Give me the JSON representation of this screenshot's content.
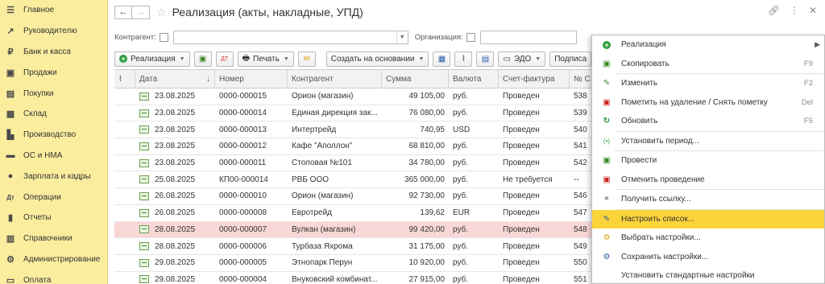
{
  "sidebar": {
    "items": [
      {
        "label": "Главное",
        "icon": "menu-icon"
      },
      {
        "label": "Руководителю",
        "icon": "chart-icon"
      },
      {
        "label": "Банк и касса",
        "icon": "bank-icon"
      },
      {
        "label": "Продажи",
        "icon": "sales-icon"
      },
      {
        "label": "Покупки",
        "icon": "cart-icon"
      },
      {
        "label": "Склад",
        "icon": "warehouse-icon"
      },
      {
        "label": "Производство",
        "icon": "factory-icon"
      },
      {
        "label": "ОС и НМА",
        "icon": "truck-icon"
      },
      {
        "label": "Зарплата и кадры",
        "icon": "people-icon"
      },
      {
        "label": "Операции",
        "icon": "operations-icon"
      },
      {
        "label": "Отчеты",
        "icon": "reports-icon"
      },
      {
        "label": "Справочники",
        "icon": "book-icon"
      },
      {
        "label": "Администрирование",
        "icon": "gear-icon"
      },
      {
        "label": "Оплата",
        "icon": "payment-icon"
      }
    ]
  },
  "header": {
    "title": "Реализация (акты, накладные, УПД)"
  },
  "filters": {
    "counterparty_label": "Контрагент:",
    "organization_label": "Организация:"
  },
  "toolbar": {
    "create_label": "Реализация",
    "print_label": "Печать",
    "create_based_label": "Создать на основании",
    "edo_label": "ЭДО",
    "sign_label": "Подписа"
  },
  "table": {
    "columns": [
      "Дата",
      "Номер",
      "Контрагент",
      "Сумма",
      "Валюта",
      "Счет-фактура",
      "№ С"
    ],
    "rows": [
      {
        "date": "23.08.2025",
        "number": "0000-000015",
        "counterparty": "Орион (магазин)",
        "sum": "49 105,00",
        "currency": "руб.",
        "invoice": "Проведен",
        "num": "538"
      },
      {
        "date": "23.08.2025",
        "number": "0000-000014",
        "counterparty": "Единая дирекция зак...",
        "sum": "76 080,00",
        "currency": "руб.",
        "invoice": "Проведен",
        "num": "539"
      },
      {
        "date": "23.08.2025",
        "number": "0000-000013",
        "counterparty": "Интертрейд",
        "sum": "740,95",
        "currency": "USD",
        "invoice": "Проведен",
        "num": "540"
      },
      {
        "date": "23.08.2025",
        "number": "0000-000012",
        "counterparty": "Кафе \"Аполлон\"",
        "sum": "68 810,00",
        "currency": "руб.",
        "invoice": "Проведен",
        "num": "541"
      },
      {
        "date": "23.08.2025",
        "number": "0000-000011",
        "counterparty": "Столовая №101",
        "sum": "34 780,00",
        "currency": "руб.",
        "invoice": "Проведен",
        "num": "542"
      },
      {
        "date": "25.08.2025",
        "number": "КП00-000014",
        "counterparty": "РВБ ООО",
        "sum": "365 000,00",
        "currency": "руб.",
        "invoice": "Не требуется",
        "num": "--"
      },
      {
        "date": "26.08.2025",
        "number": "0000-000010",
        "counterparty": "Орион (магазин)",
        "sum": "92 730,00",
        "currency": "руб.",
        "invoice": "Проведен",
        "num": "546"
      },
      {
        "date": "26.08.2025",
        "number": "0000-000008",
        "counterparty": "Евротрейд",
        "sum": "139,62",
        "currency": "EUR",
        "invoice": "Проведен",
        "num": "547"
      },
      {
        "date": "28.08.2025",
        "number": "0000-000007",
        "counterparty": "Вулкан (магазин)",
        "sum": "99 420,00",
        "currency": "руб.",
        "invoice": "Проведен",
        "num": "548"
      },
      {
        "date": "28.08.2025",
        "number": "0000-000006",
        "counterparty": "Турбаза Яхрома",
        "sum": "31 175,00",
        "currency": "руб.",
        "invoice": "Проведен",
        "num": "549"
      },
      {
        "date": "29.08.2025",
        "number": "0000-000005",
        "counterparty": "Этнопарк Перун",
        "sum": "10 920,00",
        "currency": "руб.",
        "invoice": "Проведен",
        "num": "550"
      },
      {
        "date": "29.08.2025",
        "number": "0000-000004",
        "counterparty": "Внуковский комбинат...",
        "sum": "27 915,00",
        "currency": "руб.",
        "invoice": "Проведен",
        "num": "551"
      }
    ]
  },
  "context_menu": {
    "items": [
      {
        "label": "Реализация",
        "key": "",
        "icon": "plus-circle-icon"
      },
      {
        "label": "Скопировать",
        "key": "F9",
        "icon": "copy-icon"
      },
      {
        "label": "Изменить",
        "key": "F2",
        "icon": "pencil-icon"
      },
      {
        "label": "Пометить на удаление / Снять пометку",
        "key": "Del",
        "icon": "delete-mark-icon"
      },
      {
        "label": "Обновить",
        "key": "F5",
        "icon": "refresh-icon"
      },
      {
        "label": "Установить период...",
        "key": "",
        "icon": "period-icon"
      },
      {
        "label": "Провести",
        "key": "",
        "icon": "post-icon"
      },
      {
        "label": "Отменить проведение",
        "key": "",
        "icon": "unpost-icon"
      },
      {
        "label": "Получить ссылку...",
        "key": "",
        "icon": "link-icon"
      },
      {
        "label": "Настроить список...",
        "key": "",
        "icon": "settings-list-icon"
      },
      {
        "label": "Выбрать настройки...",
        "key": "",
        "icon": "choose-settings-icon"
      },
      {
        "label": "Сохранить настройки...",
        "key": "",
        "icon": "save-settings-icon"
      },
      {
        "label": "Установить стандартные настройки",
        "key": "",
        "icon": ""
      }
    ]
  },
  "colors": {
    "sidebar_bg": "#fbed9e",
    "menu_active": "#fbd43a",
    "row_highlight": "#f9d7d7",
    "green": "#2e9e3e"
  }
}
